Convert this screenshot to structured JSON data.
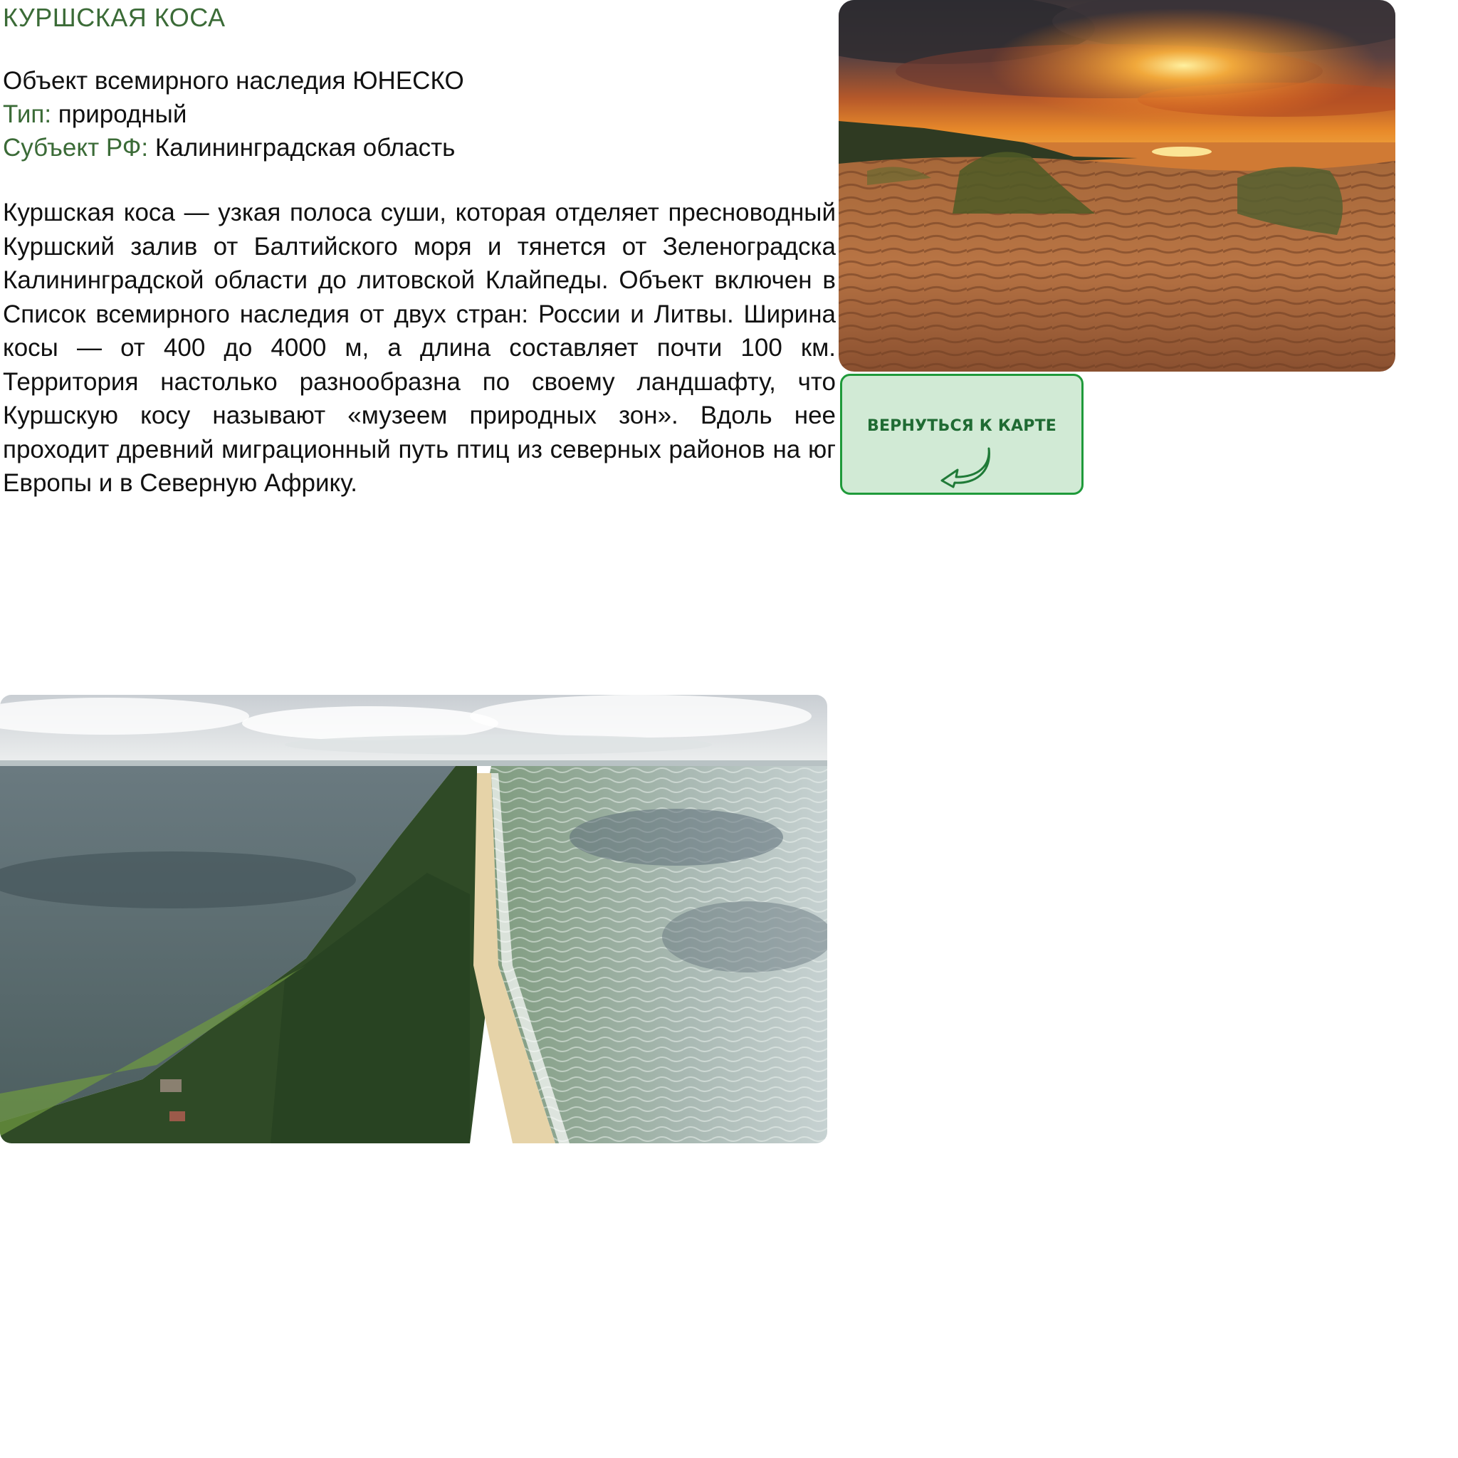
{
  "title": "КУРШСКАЯ КОСА",
  "info": {
    "unesco": "Объект всемирного наследия ЮНЕСКО",
    "type_key": "Тип:",
    "type_value": " природный",
    "subject_key": "Субъект РФ:",
    "subject_value": " Калининградская область"
  },
  "description": " Куршская коса — узкая полоса суши, которая отделяет пресноводный Куршский залив от Балтийского моря и тянется от Зеленоградска Калининградской области до литовской Клайпеды. Объект включен в Список всемирного наследия от двух стран: России и Литвы. Ширина косы — от 400 до 4000 м, а длина составляет почти 100 км. Территория настолько разнообразна по своему ландшафту, что Куршскую косу называют «музеем природных зон». Вдоль нее проходит древний миграционный путь птиц из северных районов на юг Европы и в Северную Африку.",
  "back_button": {
    "label": "ВЕРНУТЬСЯ К КАРТЕ",
    "icon": "back-arrow-icon"
  },
  "colors": {
    "accent_green": "#3b6b37",
    "button_bg": "#d1ead5",
    "button_border": "#1f9a3a",
    "button_text": "#1f6b33"
  }
}
